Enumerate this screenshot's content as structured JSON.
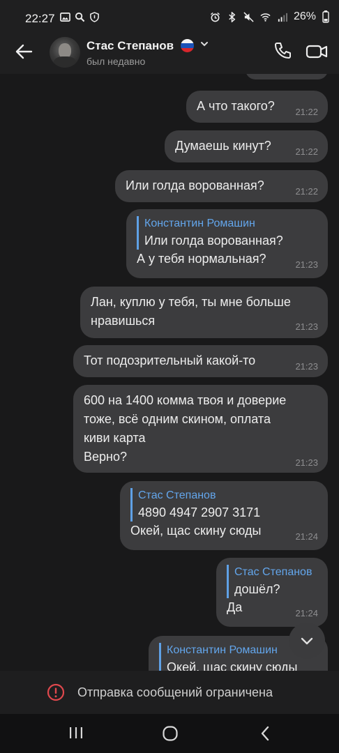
{
  "status_bar": {
    "time": "22:27",
    "battery": "26%"
  },
  "header": {
    "contact_name": "Стас Степанов",
    "contact_status": "был недавно"
  },
  "messages": [
    {
      "text": "А что такого?",
      "time": "21:22"
    },
    {
      "text": "Думаешь кинут?",
      "time": "21:22"
    },
    {
      "text": "Или голда ворованная?",
      "time": "21:22"
    },
    {
      "reply_name": "Константин Ромашин",
      "reply_text": "Или голда ворованная?",
      "text": "А у тебя нормальная?",
      "time": "21:23"
    },
    {
      "text_line1": "Лан, куплю у тебя, ты мне больше",
      "text_line2": "нравишься",
      "time": "21:23"
    },
    {
      "text": "Тот подозрительный какой-то",
      "time": "21:23"
    },
    {
      "text_line1": "600 на 1400 комма твоя и доверие",
      "text_line2": "тоже, всё одним скином, оплата",
      "text_line3": "киви карта",
      "text_line4": "Верно?",
      "time": "21:23"
    },
    {
      "reply_name": "Стас Степанов",
      "reply_text": "4890 4947 2907 3171",
      "text": "Окей, щас скину сюды",
      "time": "21:24"
    },
    {
      "reply_name": "Стас Степанов",
      "reply_text": "дошёл?",
      "text": "Да",
      "time": "21:24"
    },
    {
      "reply_name": "Константин Ромашин",
      "reply_text": "Окей, щас скину сюды"
    }
  ],
  "restriction": {
    "text": "Отправка сообщений ограничена"
  },
  "colors": {
    "background": "#19191a",
    "bubble": "#3c3c3e",
    "accent": "#5fa1e6",
    "warning": "#e0484d"
  },
  "icons": [
    "back-arrow-icon",
    "phone-icon",
    "video-call-icon",
    "chevron-down-icon",
    "warning-icon",
    "nav-recents-icon",
    "nav-home-icon",
    "nav-back-icon"
  ]
}
